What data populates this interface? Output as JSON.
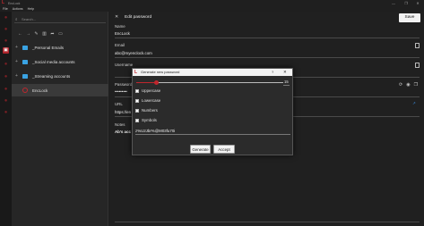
{
  "window": {
    "title": "EncLock",
    "controls": [
      "—",
      "❐",
      "✕"
    ]
  },
  "menu": [
    "File",
    "Actions",
    "Help"
  ],
  "sidebar": {
    "search_placeholder": "Search...",
    "toolbar_icons": [
      "arrow-left-icon",
      "arrow-right-icon",
      "pencil-icon",
      "trash-icon",
      "move-icon",
      "new-folder-icon"
    ],
    "items": [
      {
        "label": "_Personal Emails",
        "type": "folder"
      },
      {
        "label": "_Social media accounts",
        "type": "folder"
      },
      {
        "label": "_Streaming accounts",
        "type": "folder"
      },
      {
        "label": "EncLock",
        "type": "lock",
        "selected": true
      }
    ]
  },
  "editor": {
    "title": "Edit password",
    "save_label": "Save",
    "fields": {
      "name_label": "Name",
      "name_value": "EncLock",
      "email_label": "Email",
      "email_value": "abc@myenclock.com",
      "username_label": "Username",
      "password_label": "Password",
      "password_value": "•••••••••",
      "url_label": "URL",
      "url_value": "https://en",
      "notes_label": "Notes",
      "notes_value": "Ab's acc"
    }
  },
  "dialog": {
    "title": "Generate new password",
    "help": "?",
    "close": "✕",
    "length": "15",
    "length_fraction": 0.14,
    "options": [
      {
        "label": "Uppercase",
        "checked": true
      },
      {
        "label": "Lowercase",
        "checked": true
      },
      {
        "label": "Numbers",
        "checked": true
      },
      {
        "label": "Symbols",
        "checked": true
      }
    ],
    "generated": "z%U2Jbr%@M03fu70i",
    "generate_label": "Generate",
    "accept_label": "Accept"
  },
  "colors": {
    "accent": "#c0262d",
    "link": "#3a8de0",
    "folder": "#3aa3e3"
  }
}
